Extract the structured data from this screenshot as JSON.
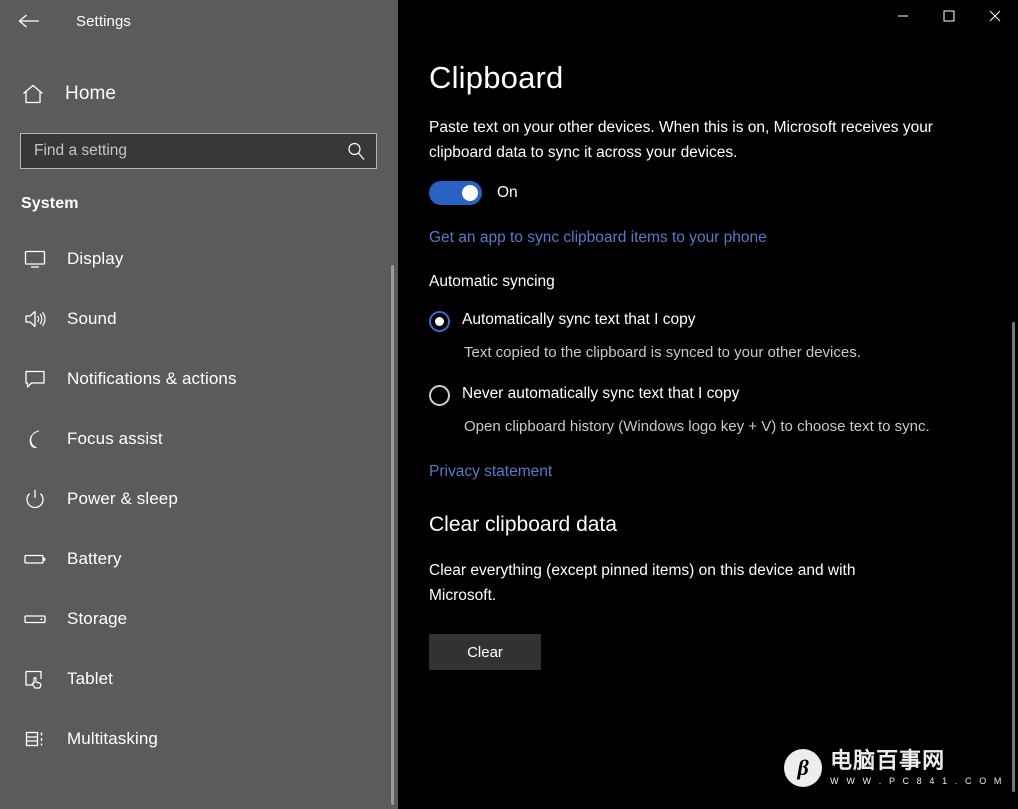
{
  "window": {
    "app_title": "Settings",
    "back_icon": "back-arrow-icon",
    "controls": {
      "minimize": "minimize-icon",
      "maximize": "maximize-icon",
      "close": "close-icon"
    }
  },
  "sidebar": {
    "home_label": "Home",
    "home_icon": "home-icon",
    "search": {
      "placeholder": "Find a setting",
      "value": "",
      "icon": "search-icon"
    },
    "section_heading": "System",
    "items": [
      {
        "label": "Display",
        "icon": "monitor-icon"
      },
      {
        "label": "Sound",
        "icon": "speaker-icon"
      },
      {
        "label": "Notifications & actions",
        "icon": "chat-bubble-icon"
      },
      {
        "label": "Focus assist",
        "icon": "moon-icon"
      },
      {
        "label": "Power & sleep",
        "icon": "power-icon"
      },
      {
        "label": "Battery",
        "icon": "battery-icon"
      },
      {
        "label": "Storage",
        "icon": "drive-icon"
      },
      {
        "label": "Tablet",
        "icon": "tablet-touch-icon"
      },
      {
        "label": "Multitasking",
        "icon": "multitasking-icon"
      }
    ]
  },
  "main": {
    "page_title": "Clipboard",
    "description": "Paste text on your other devices. When this is on, Microsoft receives your clipboard data to sync it across your devices.",
    "toggle": {
      "state_label": "On",
      "checked": true,
      "accent_color": "#2a62c4"
    },
    "phone_link": "Get an app to sync clipboard items to your phone",
    "automatic_syncing": {
      "group_label": "Automatic syncing",
      "options": [
        {
          "label": "Automatically sync text that I copy",
          "help": "Text copied to the clipboard is synced to your other devices.",
          "selected": true
        },
        {
          "label": "Never automatically sync text that I copy",
          "help": "Open clipboard history (Windows logo key + V) to choose text to sync.",
          "selected": false
        }
      ]
    },
    "privacy_link": "Privacy statement",
    "clear_section": {
      "title": "Clear clipboard data",
      "description": "Clear everything (except pinned items) on this device and with Microsoft.",
      "button_label": "Clear"
    }
  },
  "watermark": {
    "logo_glyph": "β",
    "name": "电脑百事网",
    "url": "W W W . P C 8 4 1 . C O M"
  },
  "colors": {
    "sidebar_bg": "#5b5b5b",
    "main_bg": "#000000",
    "link": "#5b78c7",
    "accent": "#2a62c4",
    "button_bg": "#323232"
  }
}
